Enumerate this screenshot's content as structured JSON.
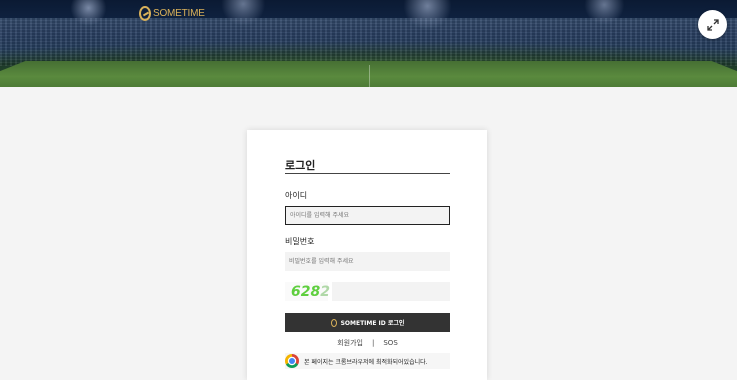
{
  "header": {
    "logo_text": "SOMETIME",
    "expand_icon": "expand-arrows-icon"
  },
  "login": {
    "title": "로그인",
    "id_label": "아이디",
    "id_placeholder": "아이디를 입력해 주세요",
    "pw_label": "비밀번호",
    "pw_placeholder": "비밀번호를 입력해 주세요",
    "captcha_main": "628",
    "captcha_faded": "2",
    "button_label": "SOMETIME ID 로그인",
    "signup_link": "회원가입",
    "separator": "|",
    "sos_link": "SOS",
    "browser_notice": "본 페이지는 크롬브라우저에 최적화되어있습니다."
  },
  "colors": {
    "brand_gold": "#d9b15a",
    "button_dark": "#333333",
    "captcha_green": "#5fcf3f"
  }
}
